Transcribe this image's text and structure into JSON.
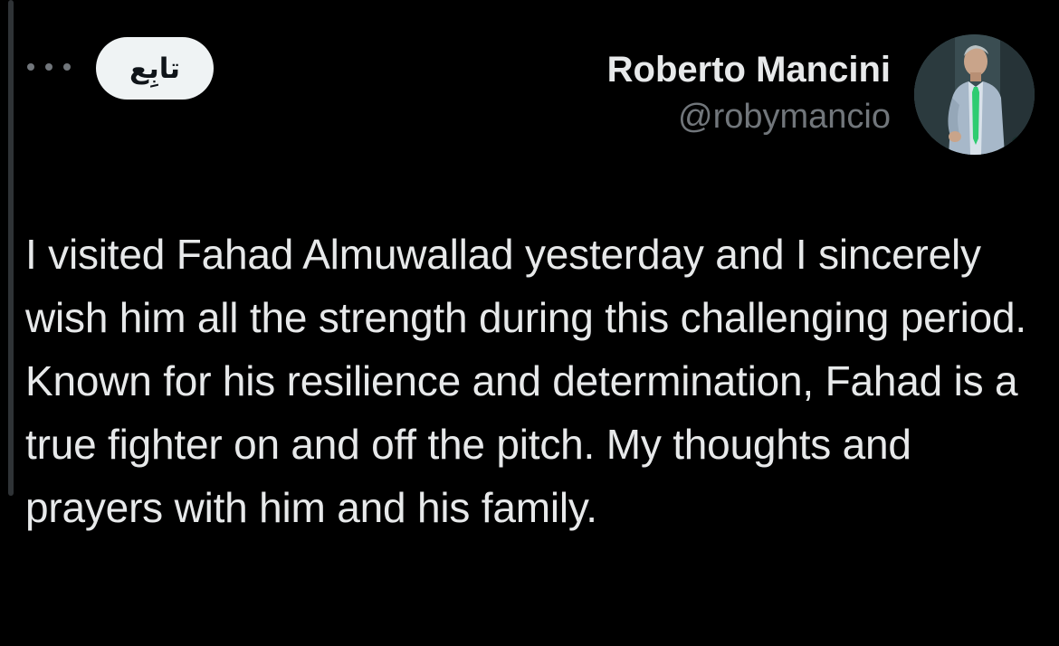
{
  "tweet": {
    "follow_label": "تابِع",
    "author": {
      "display_name": "Roberto Mancini",
      "handle": "@robymancio",
      "avatar_icon": "profile-photo"
    },
    "text": "I visited Fahad Almuwallad yesterday and I sincerely wish him all the strength during this challenging period. Known for his resilience and determination, Fahad is a true fighter on and off the pitch. My thoughts and prayers with him and his family."
  },
  "colors": {
    "background": "#000000",
    "primary_text": "#e7e9ea",
    "secondary_text": "#71767b",
    "follow_button_bg": "#eff3f4",
    "follow_button_text": "#0f1419",
    "accent_tie": "#2ecc71"
  }
}
